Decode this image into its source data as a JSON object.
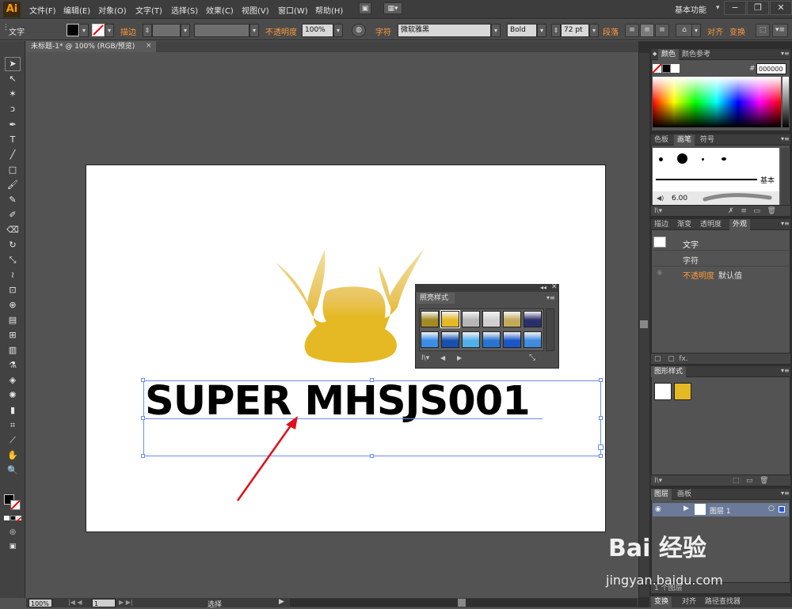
{
  "app": {
    "logo": "Ai"
  },
  "menu": [
    "文件(F)",
    "编辑(E)",
    "对象(O)",
    "文字(T)",
    "选择(S)",
    "效果(C)",
    "视图(V)",
    "窗口(W)",
    "帮助(H)"
  ],
  "workspace": "基本功能",
  "window_controls": [
    "−",
    "❐",
    "✕"
  ],
  "control_bar": {
    "tool_label": "文字",
    "stroke_label": "描边",
    "opacity_label": "不透明度",
    "opacity_value": "100%",
    "char_label": "字符",
    "font_family": "微软雅黑",
    "font_style": "Bold",
    "font_size": "72 pt",
    "paragraph_label": "段落",
    "align_label": "对齐",
    "transform_label": "变换"
  },
  "document_tab": {
    "title": "未标题-1* @ 100% (RGB/预览)",
    "close": "×"
  },
  "artboard": {
    "headline": "SUPER MHSJS001"
  },
  "graphic_style_library": {
    "tab": "照亮样式",
    "swatches": [
      "#a48a22",
      "#e5b923",
      "#b6b6b6",
      "#d0d0d0",
      "#c3aa5b",
      "#2b2f6b",
      "#3a8ee8",
      "#1650b2",
      "#51b0ec",
      "#2774d2",
      "#1a56c8",
      "#3e8be0"
    ]
  },
  "color_panel": {
    "tabs": [
      "颜色",
      "颜色参考"
    ],
    "hex_label": "#",
    "hex_value": "000000"
  },
  "brush_panel": {
    "tabs": [
      "色板",
      "画笔",
      "符号"
    ],
    "basic_label": "基本",
    "size_value": "6.00"
  },
  "appearance_panel": {
    "tabs": [
      "描边",
      "渐变",
      "透明度",
      "外观"
    ],
    "rows": [
      {
        "label": "文字"
      },
      {
        "label": "字符"
      },
      {
        "label": "不透明度",
        "value": "默认值"
      }
    ],
    "fx": "fx."
  },
  "graphic_styles_panel": {
    "tabs": [
      "图形样式"
    ],
    "swatch_colors": [
      "#ffffff",
      "#e5b923"
    ]
  },
  "layers_panel": {
    "tabs": [
      "图层",
      "画板"
    ],
    "layer_name": "图层 1",
    "count_label": "1 个图层"
  },
  "bottom_dock_tabs": [
    "变换",
    "对齐",
    "路径查找器"
  ],
  "status_bar": {
    "zoom": "100%",
    "page": "1",
    "mode": "选择"
  },
  "watermark": {
    "logo": "Bai 经验",
    "url": "jingyan.baidu.com"
  },
  "colors": {
    "accent_orange": "#ff9a3c",
    "selection_blue": "#6a8ee6",
    "crown_gold": "#e5b923",
    "arrow_red": "#e0101a"
  }
}
